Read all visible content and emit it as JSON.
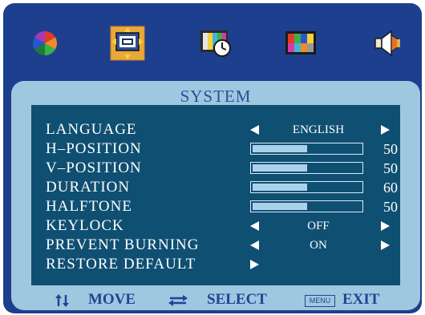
{
  "tabs": [
    {
      "id": "color",
      "icon": "color-wheel-icon"
    },
    {
      "id": "system",
      "icon": "system-settings-icon",
      "selected": true
    },
    {
      "id": "timer",
      "icon": "clock-icon"
    },
    {
      "id": "picture",
      "icon": "picture-test-pattern-icon"
    },
    {
      "id": "audio",
      "icon": "speaker-icon"
    }
  ],
  "panel": {
    "title": "SYSTEM"
  },
  "menu": [
    {
      "label": "LANGUAGE",
      "type": "select",
      "value": "ENGLISH"
    },
    {
      "label": "H–POSITION",
      "type": "slider",
      "value": "50",
      "level": 0.5
    },
    {
      "label": "V–POSITION",
      "type": "slider",
      "value": "50",
      "level": 0.5
    },
    {
      "label": "DURATION",
      "type": "slider",
      "value": "60",
      "level": 0.5
    },
    {
      "label": "HALFTONE",
      "type": "slider",
      "value": "50",
      "level": 0.5
    },
    {
      "label": "KEYLOCK",
      "type": "select",
      "value": "OFF"
    },
    {
      "label": "PREVENT BURNING",
      "type": "select",
      "value": "ON"
    },
    {
      "label": "RESTORE DEFAULT",
      "type": "action"
    }
  ],
  "footer": {
    "move_label": "MOVE",
    "select_label": "SELECT",
    "menu_key": "MENU",
    "exit_label": "EXIT"
  },
  "colors": {
    "frame": "#1d3f8e",
    "panel": "#9fc7e0",
    "content": "#0f4f72",
    "text": "#ffffff",
    "footer_text": "#1f4592"
  }
}
